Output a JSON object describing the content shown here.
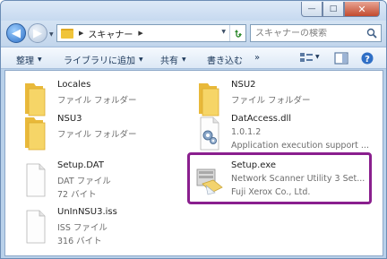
{
  "address": {
    "crumbs": [
      "スキャナー"
    ]
  },
  "search": {
    "placeholder": "スキャナーの検索"
  },
  "toolbar": {
    "organize": "整理",
    "library": "ライブラリに追加",
    "share": "共有",
    "burn": "書き込む",
    "more": "»"
  },
  "files": [
    {
      "name": "Locales",
      "line2": "ファイル フォルダー",
      "line3": "",
      "icon": "folder-icon"
    },
    {
      "name": "NSU2",
      "line2": "ファイル フォルダー",
      "line3": "",
      "icon": "folder-icon"
    },
    {
      "name": "NSU3",
      "line2": "ファイル フォルダー",
      "line3": "",
      "icon": "folder-icon"
    },
    {
      "name": "DatAccess.dll",
      "line2": "1.0.1.2",
      "line3": "Application execution support ...",
      "icon": "dll-file-icon"
    },
    {
      "name": "Setup.DAT",
      "line2": "DAT ファイル",
      "line3": "72 バイト",
      "icon": "blank-file-icon"
    },
    {
      "name": "Setup.exe",
      "line2": "Network Scanner Utility 3 Set...",
      "line3": "Fuji Xerox Co., Ltd.",
      "icon": "installer-icon"
    },
    {
      "name": "UnInNSU3.iss",
      "line2": "ISS ファイル",
      "line3": "316 バイト",
      "icon": "blank-file-icon"
    }
  ],
  "colors": {
    "highlight": "#8a1f8e",
    "folder": "#f0c43a"
  }
}
